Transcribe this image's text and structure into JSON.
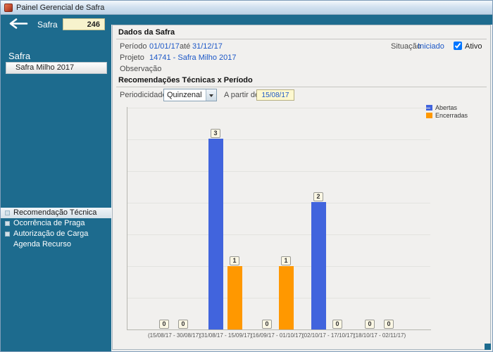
{
  "window": {
    "title": "Painel Gerencial de Safra"
  },
  "toolbar": {
    "entity_label": "Safra",
    "entity_id": "246"
  },
  "sidebar": {
    "title": "Safra",
    "selected_safra": "Safra Milho 2017",
    "menu": [
      {
        "label": "Recomendação Técnica",
        "selected": true,
        "bullet": true
      },
      {
        "label": "Ocorrência de Praga",
        "selected": false,
        "bullet": true
      },
      {
        "label": "Autorização de Carga",
        "selected": false,
        "bullet": true
      },
      {
        "label": "Agenda Recurso",
        "selected": false,
        "bullet": false
      }
    ]
  },
  "dados": {
    "section_title": "Dados da Safra",
    "periodo_label": "Período",
    "periodo_inicio": "01/01/17",
    "ate_label": "até",
    "periodo_fim": "31/12/17",
    "projeto_label": "Projeto",
    "projeto_value": "14741 - Safra Milho 2017",
    "observacao_label": "Observação",
    "situacao_label": "Situação",
    "situacao_value": "Iniciado",
    "ativo_label": "Ativo",
    "ativo_checked": true
  },
  "recomendacoes": {
    "section_title": "Recomendações Técnicas x Período",
    "periodicidade_label": "Periodicidade",
    "periodicidade_value": "Quinzenal",
    "a_partir_label": "A partir de",
    "a_partir_value": "15/08/17"
  },
  "chart_data": {
    "type": "bar",
    "title": "Recomendações Técnicas x Período",
    "categories": [
      "(15/08/17 - 30/08/17)",
      "(31/08/17 - 15/09/17)",
      "(16/09/17 - 01/10/17)",
      "(02/10/17 - 17/10/17)",
      "(18/10/17 - 02/11/17)"
    ],
    "series": [
      {
        "name": "Abertas",
        "color": "#4164dd",
        "values": [
          0,
          3,
          0,
          2,
          0
        ]
      },
      {
        "name": "Encerradas",
        "color": "#ff9800",
        "values": [
          0,
          1,
          1,
          0,
          0
        ]
      }
    ],
    "ylim": [
      0,
      3.5
    ],
    "grid": true,
    "legend_position": "top-right",
    "value_labels": true
  },
  "colors": {
    "teal": "#1d6b8e",
    "link_blue": "#1d58c7",
    "bar_blue": "#4164dd",
    "bar_orange": "#ff9800",
    "highlight_yellow": "#f7f3cd"
  }
}
